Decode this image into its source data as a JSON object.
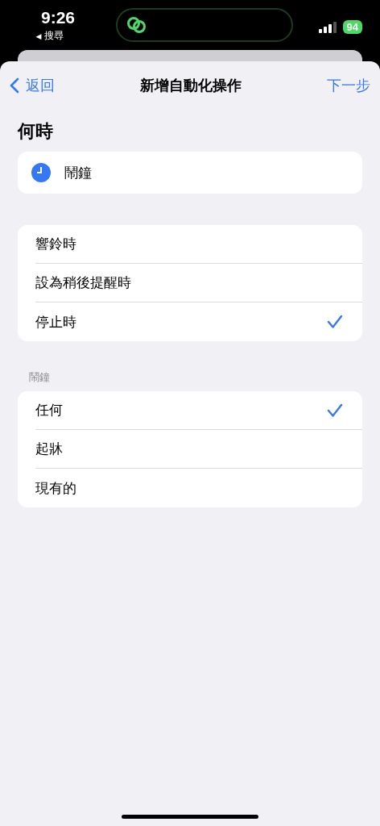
{
  "status_bar": {
    "time": "9:26",
    "back_arrow": "◀",
    "back_app": "搜尋",
    "battery": "94"
  },
  "nav": {
    "back": "返回",
    "title": "新增自動化操作",
    "next": "下一步"
  },
  "heading": "何時",
  "trigger": {
    "label": "鬧鐘"
  },
  "event_options": [
    {
      "label": "響鈴時",
      "selected": false
    },
    {
      "label": "設為稍後提醒時",
      "selected": false
    },
    {
      "label": "停止時",
      "selected": true
    }
  ],
  "alarm_section": {
    "header": "鬧鐘",
    "options": [
      {
        "label": "任何",
        "selected": true
      },
      {
        "label": "起牀",
        "selected": false
      },
      {
        "label": "現有的",
        "selected": false
      }
    ]
  }
}
